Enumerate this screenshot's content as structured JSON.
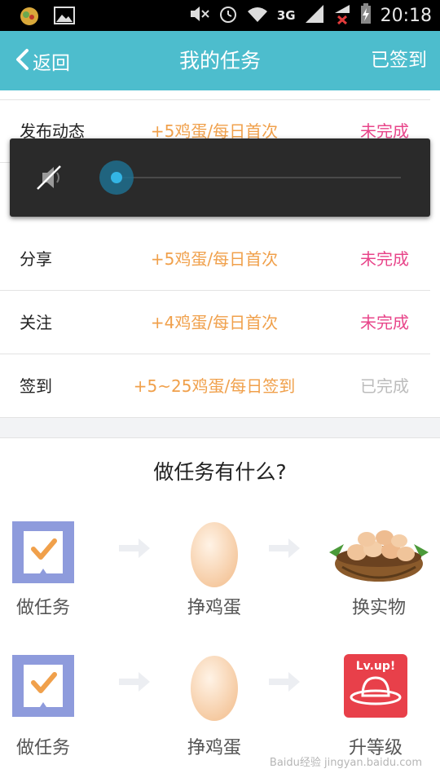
{
  "status_bar": {
    "time": "20:18",
    "network": "3G",
    "icons": [
      "app-icon",
      "image-icon",
      "mute-icon",
      "alarm-icon",
      "wifi-icon",
      "signal-icon",
      "signal-no-sim-icon",
      "battery-charging-icon"
    ]
  },
  "header": {
    "back_label": "返回",
    "title": "我的任务",
    "signed_label": "已签到",
    "accent": "#4dbdcd"
  },
  "tasks": [
    {
      "name": "发布动态",
      "reward": "+5鸡蛋/每日首次",
      "status": "未完成"
    },
    {
      "name": "分享",
      "reward": "+5鸡蛋/每日首次",
      "status": "未完成"
    },
    {
      "name": "关注",
      "reward": "+4鸡蛋/每日首次",
      "status": "未完成"
    },
    {
      "name": "签到",
      "reward": "+5~25鸡蛋/每日签到",
      "status": "已完成"
    }
  ],
  "colors": {
    "reward": "#f0a04b",
    "status_todo": "#e8458a",
    "status_done": "#bcbcbc"
  },
  "info": {
    "title": "做任务有什么?",
    "rows": [
      {
        "steps": [
          {
            "label": "做任务",
            "icon": "task-check-icon"
          },
          {
            "label": "挣鸡蛋",
            "icon": "egg-icon"
          },
          {
            "label": "换实物",
            "icon": "egg-basket-icon"
          }
        ]
      },
      {
        "steps": [
          {
            "label": "做任务",
            "icon": "task-check-icon"
          },
          {
            "label": "挣鸡蛋",
            "icon": "egg-icon"
          },
          {
            "label": "升等级",
            "icon": "level-up-icon"
          }
        ]
      }
    ],
    "level_badge_text": "Lv.up!"
  },
  "volume": {
    "level": 0,
    "icon": "speaker-muted-icon"
  },
  "watermark": "Baidu经验 jingyan.baidu.com"
}
